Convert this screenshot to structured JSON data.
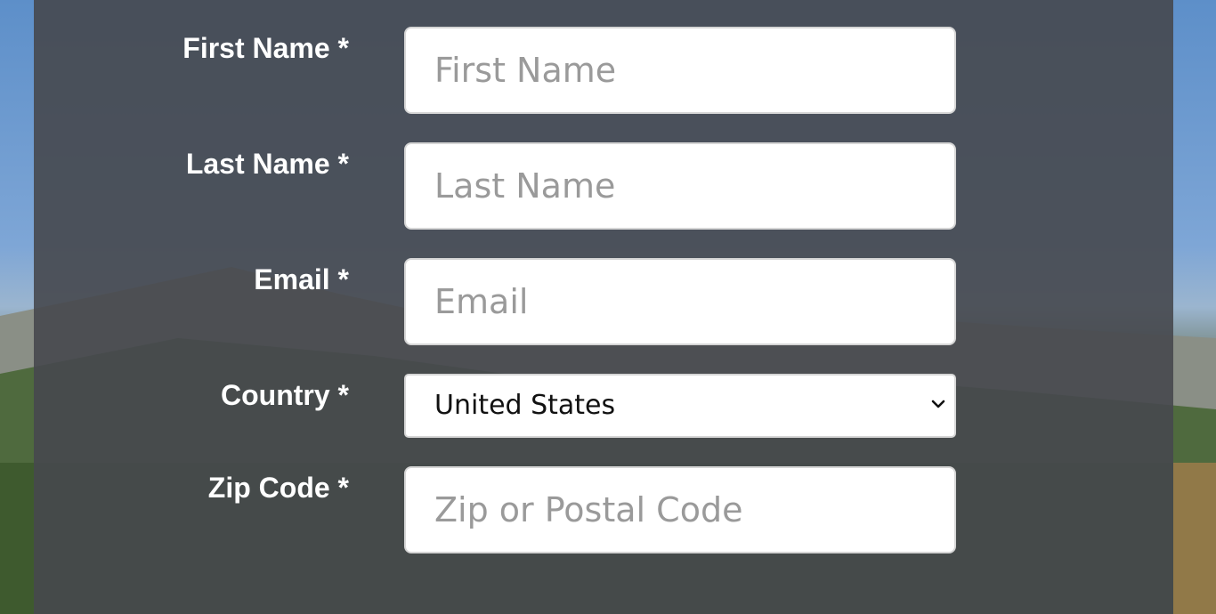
{
  "form": {
    "first_name": {
      "label": "First Name *",
      "placeholder": "First Name",
      "value": ""
    },
    "last_name": {
      "label": "Last Name *",
      "placeholder": "Last Name",
      "value": ""
    },
    "email": {
      "label": "Email *",
      "placeholder": "Email",
      "value": ""
    },
    "country": {
      "label": "Country *",
      "selected": "United States"
    },
    "zip": {
      "label": "Zip Code *",
      "placeholder": "Zip or Postal Code",
      "value": ""
    }
  },
  "icons": {
    "country_dropdown": "chevron-down-icon"
  },
  "colors": {
    "panel_overlay": "#46484e",
    "label_text": "#ffffff",
    "placeholder_text": "#9a9a9a",
    "field_border": "#d6d6d6"
  }
}
